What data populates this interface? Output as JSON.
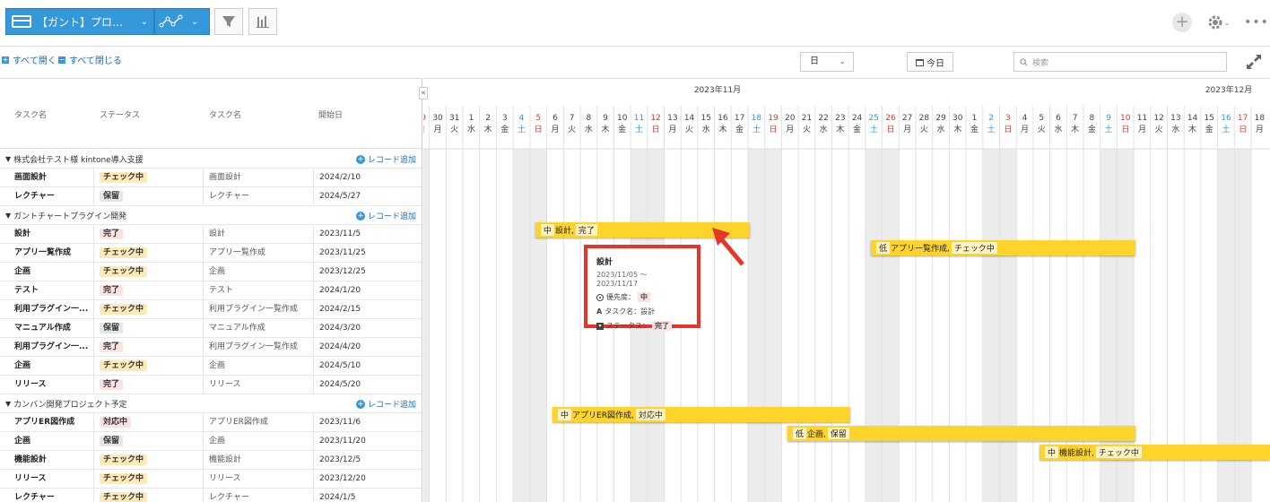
{
  "toolbar": {
    "view_name": "【ガント】プロジェ…",
    "view_chevron": "⌄",
    "graph_chevron": "⌄"
  },
  "tools": {
    "expand_all": "すべて開く",
    "collapse_all": "すべて閉じる",
    "unit": "日",
    "today": "今日",
    "search_placeholder": "検索"
  },
  "columns": [
    "タスク名",
    "ステータス",
    "タスク名",
    "開始日"
  ],
  "add_record_label": "レコード追加",
  "groups": [
    {
      "name": "株式会社テスト様 kintone導入支援",
      "rows": [
        {
          "task": "画面設計",
          "status": "チェック中",
          "status_key": "check",
          "name": "画面設計",
          "start": "2024/2/10"
        },
        {
          "task": "レクチャー",
          "status": "保留",
          "status_key": "hold",
          "name": "レクチャー",
          "start": "2024/5/27"
        }
      ]
    },
    {
      "name": "ガントチャートプラグイン開発",
      "rows": [
        {
          "task": "設計",
          "status": "完了",
          "status_key": "done",
          "name": "設計",
          "start": "2023/11/5"
        },
        {
          "task": "アプリ一覧作成",
          "status": "チェック中",
          "status_key": "check",
          "name": "アプリ一覧作成",
          "start": "2023/11/25"
        },
        {
          "task": "企画",
          "status": "チェック中",
          "status_key": "check",
          "name": "企画",
          "start": "2023/12/25"
        },
        {
          "task": "テスト",
          "status": "完了",
          "status_key": "done",
          "name": "テスト",
          "start": "2024/1/20"
        },
        {
          "task": "利用プラグイン一...",
          "status": "チェック中",
          "status_key": "check",
          "name": "利用プラグイン一覧作成",
          "start": "2024/2/15"
        },
        {
          "task": "マニュアル作成",
          "status": "保留",
          "status_key": "hold",
          "name": "マニュアル作成",
          "start": "2024/3/20"
        },
        {
          "task": "利用プラグイン一...",
          "status": "完了",
          "status_key": "done",
          "name": "利用プラグイン一覧作成",
          "start": "2024/4/20"
        },
        {
          "task": "企画",
          "status": "チェック中",
          "status_key": "check",
          "name": "企画",
          "start": "2024/5/10"
        },
        {
          "task": "リリース",
          "status": "完了",
          "status_key": "done",
          "name": "リリース",
          "start": "2024/5/20"
        }
      ]
    },
    {
      "name": "カンバン開発プロジェクト予定",
      "rows": [
        {
          "task": "アプリER図作成",
          "status": "対応中",
          "status_key": "resp",
          "name": "アプリER図作成",
          "start": "2023/11/6"
        },
        {
          "task": "企画",
          "status": "保留",
          "status_key": "hold",
          "name": "企画",
          "start": "2023/11/20"
        },
        {
          "task": "機能設計",
          "status": "チェック中",
          "status_key": "check",
          "name": "機能設計",
          "start": "2023/12/5"
        },
        {
          "task": "リリース",
          "status": "チェック中",
          "status_key": "check",
          "name": "リリース",
          "start": "2023/12/20"
        },
        {
          "task": "レクチャー",
          "status": "チェック中",
          "status_key": "check",
          "name": "レクチャー",
          "start": "2024/1/5"
        }
      ]
    }
  ],
  "timeline": {
    "months": [
      "2023年11月",
      "2023年12月"
    ],
    "days": [
      {
        "d": "29",
        "w": "日"
      },
      {
        "d": "30",
        "w": "月"
      },
      {
        "d": "31",
        "w": "火"
      },
      {
        "d": "1",
        "w": "水"
      },
      {
        "d": "2",
        "w": "木"
      },
      {
        "d": "3",
        "w": "金"
      },
      {
        "d": "4",
        "w": "土"
      },
      {
        "d": "5",
        "w": "日"
      },
      {
        "d": "6",
        "w": "月"
      },
      {
        "d": "7",
        "w": "火"
      },
      {
        "d": "8",
        "w": "水"
      },
      {
        "d": "9",
        "w": "木"
      },
      {
        "d": "10",
        "w": "金"
      },
      {
        "d": "11",
        "w": "土"
      },
      {
        "d": "12",
        "w": "日"
      },
      {
        "d": "13",
        "w": "月"
      },
      {
        "d": "14",
        "w": "火"
      },
      {
        "d": "15",
        "w": "水"
      },
      {
        "d": "16",
        "w": "木"
      },
      {
        "d": "17",
        "w": "金"
      },
      {
        "d": "18",
        "w": "土"
      },
      {
        "d": "19",
        "w": "日"
      },
      {
        "d": "20",
        "w": "月"
      },
      {
        "d": "21",
        "w": "火"
      },
      {
        "d": "22",
        "w": "水"
      },
      {
        "d": "23",
        "w": "木"
      },
      {
        "d": "24",
        "w": "金"
      },
      {
        "d": "25",
        "w": "土"
      },
      {
        "d": "26",
        "w": "日"
      },
      {
        "d": "27",
        "w": "月"
      },
      {
        "d": "28",
        "w": "火"
      },
      {
        "d": "29",
        "w": "水"
      },
      {
        "d": "30",
        "w": "木"
      },
      {
        "d": "1",
        "w": "金"
      },
      {
        "d": "2",
        "w": "土"
      },
      {
        "d": "3",
        "w": "日"
      },
      {
        "d": "4",
        "w": "月"
      },
      {
        "d": "5",
        "w": "火"
      },
      {
        "d": "6",
        "w": "水"
      },
      {
        "d": "7",
        "w": "木"
      },
      {
        "d": "8",
        "w": "金"
      },
      {
        "d": "9",
        "w": "土"
      },
      {
        "d": "10",
        "w": "日"
      },
      {
        "d": "11",
        "w": "月"
      },
      {
        "d": "12",
        "w": "火"
      },
      {
        "d": "13",
        "w": "水"
      },
      {
        "d": "14",
        "w": "木"
      },
      {
        "d": "15",
        "w": "金"
      },
      {
        "d": "16",
        "w": "土"
      },
      {
        "d": "17",
        "w": "日"
      },
      {
        "d": "18",
        "w": "月"
      }
    ]
  },
  "bars": [
    {
      "priority": "中",
      "label": "設計,",
      "status": "完了"
    },
    {
      "priority": "低",
      "label": "アプリ一覧作成,",
      "status": "チェック中"
    },
    {
      "priority": "中",
      "label": "アプリER図作成,",
      "status": "対応中"
    },
    {
      "priority": "低",
      "label": "企画,",
      "status": "保留"
    },
    {
      "priority": "中",
      "label": "機能設計,",
      "status": "チェック中"
    }
  ],
  "popup": {
    "title": "設計",
    "dates": "2023/11/05 ～ 2023/11/17",
    "priority_label": "優先度：",
    "priority": "中",
    "task_label": "タスク名：設計",
    "status_label": "ステータス：",
    "status": "完了"
  },
  "colors": {
    "accent": "#3498db",
    "bar": "#fcd42c",
    "sunday": "#e8352b",
    "saturday": "#3498db",
    "highlight": "#e8352b"
  }
}
